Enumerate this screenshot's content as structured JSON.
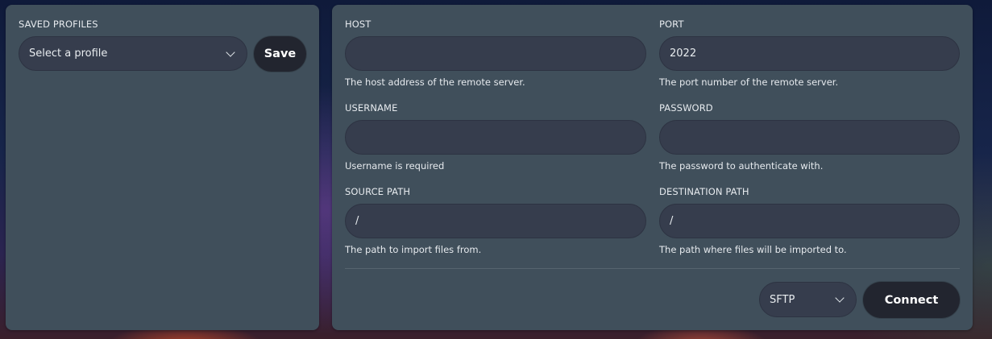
{
  "profiles": {
    "label": "SAVED PROFILES",
    "select_value": "Select a profile",
    "save_label": "Save"
  },
  "form": {
    "host": {
      "label": "HOST",
      "value": "",
      "help": "The host address of the remote server."
    },
    "port": {
      "label": "PORT",
      "value": "2022",
      "help": "The port number of the remote server."
    },
    "username": {
      "label": "USERNAME",
      "value": "",
      "help": "Username is required"
    },
    "password": {
      "label": "PASSWORD",
      "value": "",
      "help": "The password to authenticate with."
    },
    "source_path": {
      "label": "SOURCE PATH",
      "value": "/",
      "help": "The path to import files from."
    },
    "destination_path": {
      "label": "DESTINATION PATH",
      "value": "/",
      "help": "The path where files will be imported to."
    }
  },
  "footer": {
    "protocol_value": "SFTP",
    "connect_label": "Connect"
  },
  "icons": {
    "select_chevron": "chevron-down-icon"
  },
  "colors": {
    "panel": "#404f5b",
    "input": "#363d4d",
    "button": "#22252f",
    "text": "#e6eaee"
  }
}
